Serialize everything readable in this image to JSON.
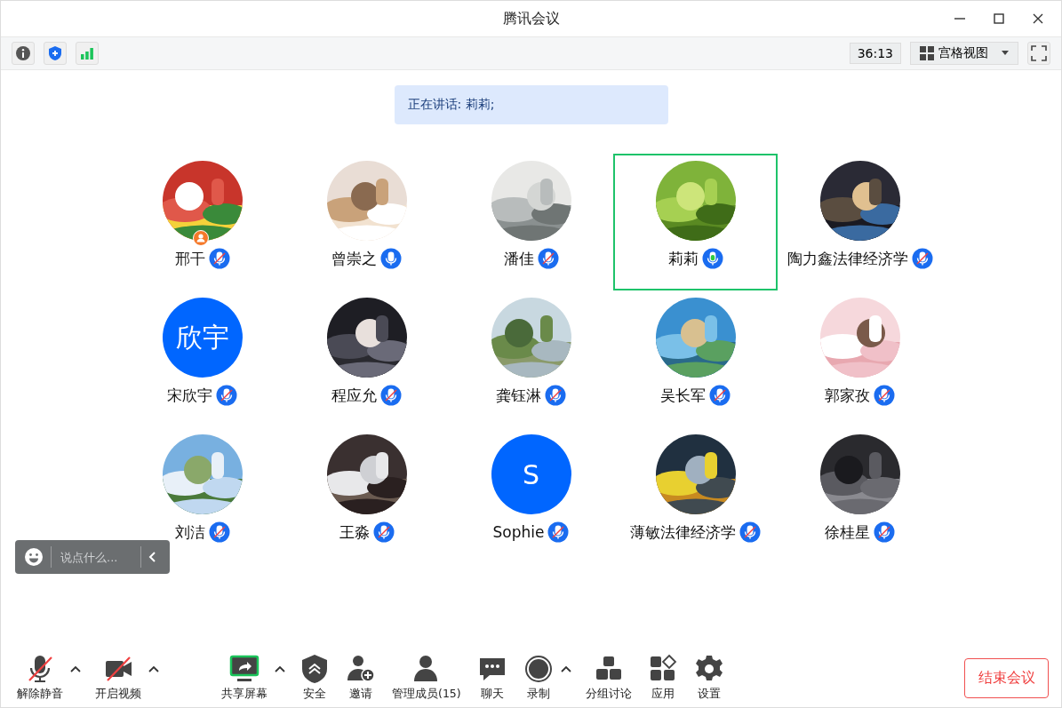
{
  "window": {
    "title": "腾讯会议"
  },
  "top_bar": {
    "timer": "36:13",
    "view_mode": "宫格视图"
  },
  "speaking_banner": "正在讲话: 莉莉;",
  "participants": [
    {
      "name": "邢干",
      "muted": true,
      "speaking": false,
      "host": true
    },
    {
      "name": "曾崇之",
      "muted": false,
      "speaking": false,
      "host": false
    },
    {
      "name": "潘佳",
      "muted": true,
      "speaking": false,
      "host": false
    },
    {
      "name": "莉莉",
      "muted": false,
      "speaking": true,
      "host": false
    },
    {
      "name": "陶力鑫法律经济学",
      "muted": true,
      "speaking": false,
      "host": false
    },
    {
      "name": "宋欣宇",
      "avatar": {
        "kind": "initials",
        "text": "欣宇"
      },
      "muted": true,
      "speaking": false,
      "host": false
    },
    {
      "name": "程应允",
      "muted": true,
      "speaking": false,
      "host": false
    },
    {
      "name": "龚钰淋",
      "muted": true,
      "speaking": false,
      "host": false
    },
    {
      "name": "吴长军",
      "muted": true,
      "speaking": false,
      "host": false
    },
    {
      "name": "郭家孜",
      "muted": true,
      "speaking": false,
      "host": false
    },
    {
      "name": "刘洁",
      "muted": true,
      "speaking": false,
      "host": false
    },
    {
      "name": "王淼",
      "muted": true,
      "speaking": false,
      "host": false
    },
    {
      "name": "Sophie",
      "avatar": {
        "kind": "initials",
        "text": "S"
      },
      "muted": true,
      "speaking": false,
      "host": false
    },
    {
      "name": "薄敏法律经济学",
      "muted": true,
      "speaking": false,
      "host": false
    },
    {
      "name": "徐桂星",
      "muted": true,
      "speaking": false,
      "host": false
    }
  ],
  "chat_input": {
    "placeholder": "说点什么..."
  },
  "toolbar_left": [
    {
      "kind": "mic",
      "label": "解除静音",
      "off": true,
      "has_menu": true
    },
    {
      "kind": "video",
      "label": "开启视频",
      "off": true,
      "has_menu": true
    }
  ],
  "toolbar_center": [
    {
      "kind": "share",
      "label": "共享屏幕",
      "off": false,
      "has_menu": true
    },
    {
      "kind": "security",
      "label": "安全",
      "off": false,
      "has_menu": false
    },
    {
      "kind": "invite",
      "label": "邀请",
      "off": false,
      "has_menu": false
    },
    {
      "kind": "members",
      "label": "管理成员(15)",
      "off": false,
      "has_menu": false
    },
    {
      "kind": "chat",
      "label": "聊天",
      "off": false,
      "has_menu": false
    },
    {
      "kind": "record",
      "label": "录制",
      "off": false,
      "has_menu": true
    },
    {
      "kind": "breakout",
      "label": "分组讨论",
      "off": false,
      "has_menu": false
    },
    {
      "kind": "apps",
      "label": "应用",
      "off": false,
      "has_menu": false
    },
    {
      "kind": "settings",
      "label": "设置",
      "off": false,
      "has_menu": false
    }
  ],
  "end_button": "结束会议"
}
